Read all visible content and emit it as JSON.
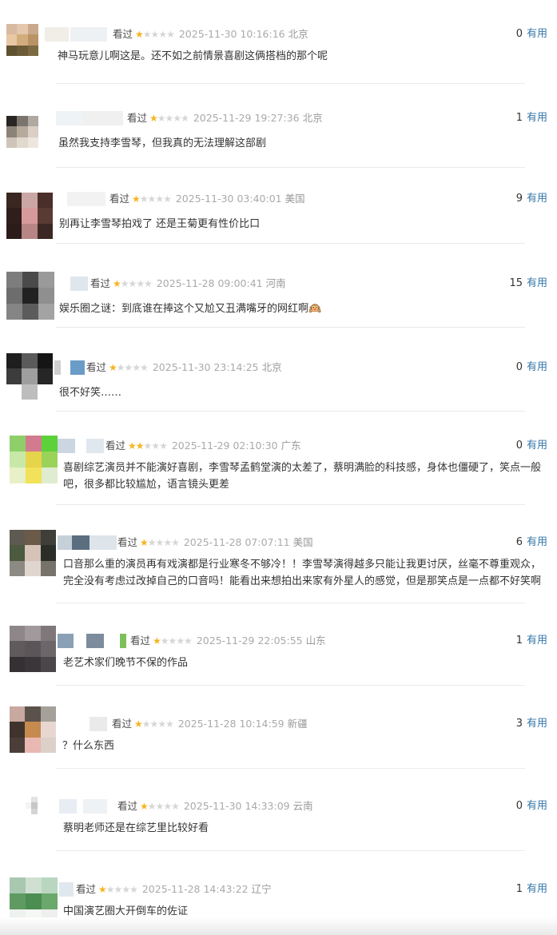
{
  "page": {
    "accent_color": "#3377aa",
    "star_on_color": "#f5b51f",
    "star_off_color": "#d6d6d6"
  },
  "reviews": [
    {
      "status": "看过",
      "rating": 1,
      "time": "2025-11-30 10:16:16",
      "location": "北京",
      "votes": "0",
      "useful_label": "有用",
      "content": "神马玩意儿啊这是。还不如之前情景喜剧这俩搭档的那个呢",
      "avatar_colors": [
        "#d8b9a1",
        "#e4c7ad",
        "#c9a98a",
        "#e8c7a4",
        "#d2ad7b",
        "#b99266",
        "#5e5230",
        "#6b5b38",
        "#7c6a42"
      ]
    },
    {
      "status": "看过",
      "rating": 1,
      "time": "2025-11-29 19:27:36",
      "location": "北京",
      "votes": "1",
      "useful_label": "有用",
      "content": "虽然我支持李雪琴，但我真的无法理解这部剧",
      "avatar_colors": [
        "#2a2623",
        "#7a746d",
        "#b0a9a1",
        "#8c8378",
        "#b7aa9d",
        "#d9cfc4",
        "#cfc4b8",
        "#e1d8ce",
        "#ece6df"
      ]
    },
    {
      "status": "看过",
      "rating": 1,
      "time": "2025-11-30 03:40:01",
      "location": "美国",
      "votes": "9",
      "useful_label": "有用",
      "content": "别再让李雪琴拍戏了 还是王菊更有性价比口",
      "avatar_colors": [
        "#3a2722",
        "#caa7a4",
        "#4a2e29",
        "#2f1e1a",
        "#d79a9c",
        "#5a3a35",
        "#2c1c19",
        "#b78583",
        "#3b2825"
      ]
    },
    {
      "status": "看过",
      "rating": 1,
      "time": "2025-11-28 09:00:41",
      "location": "河南",
      "votes": "15",
      "useful_label": "有用",
      "content": "娱乐圈之谜：到底谁在捧这个又尬又丑满嘴牙的网红啊🙉",
      "avatar_colors": [
        "#7d7d7d",
        "#4a4a4a",
        "#9a9a9a",
        "#6d6d6d",
        "#222222",
        "#8f8f8f",
        "#858585",
        "#5c5c5c",
        "#a3a3a3"
      ]
    },
    {
      "status": "看过",
      "rating": 1,
      "time": "2025-11-30 23:14:25",
      "location": "北京",
      "votes": "0",
      "useful_label": "有用",
      "content": "很不好笑……",
      "avatar_colors": [
        "#1e1e1e",
        "#5a5a5a",
        "#151515",
        "#3c3c3c",
        "#9e9e9e",
        "#262626",
        "#ffffff",
        "#bdbdbd",
        "#ffffff"
      ]
    },
    {
      "status": "看过",
      "rating": 2,
      "time": "2025-11-29 02:10:30",
      "location": "广东",
      "votes": "0",
      "useful_label": "有用",
      "content": "喜剧综艺演员并不能演好喜剧，李雪琴孟鹤堂演的太差了，蔡明满脸的科技感，身体也僵硬了，笑点一般吧，很多都比较尴尬，语言镜头更差",
      "avatar_colors": [
        "#8fcf6a",
        "#d27b8f",
        "#5dd13a",
        "#c8e8a8",
        "#e6d44a",
        "#9bd35a",
        "#e8f0c8",
        "#f2e25a",
        "#e0ecd0"
      ]
    },
    {
      "status": "看过",
      "rating": 1,
      "time": "2025-11-28 07:07:11",
      "location": "美国",
      "votes": "6",
      "useful_label": "有用",
      "content": "口音那么重的演员再有戏演都是行业寒冬不够冷！！李雪琴演得越多只能让我更讨厌，丝毫不尊重观众，完全没有考虑过改掉自己的口音吗！能看出来想拍出来家有外星人的感觉，但是那笑点是一点都不好笑啊",
      "avatar_colors": [
        "#5e5a52",
        "#6b5a48",
        "#3d3f38",
        "#4c5a3f",
        "#d6c2b6",
        "#2b2d28",
        "#8c8a82",
        "#e0d6cf",
        "#77736b"
      ]
    },
    {
      "status": "看过",
      "rating": 1,
      "time": "2025-11-29 22:05:55",
      "location": "山东",
      "votes": "1",
      "useful_label": "有用",
      "content": "老艺术家们晚节不保的作品",
      "avatar_colors": [
        "#8e8689",
        "#a09a9d",
        "#7f777a",
        "#605a5d",
        "#5a5558",
        "#6c6669",
        "#343033",
        "#3b3739",
        "#4a4649"
      ]
    },
    {
      "status": "看过",
      "rating": 1,
      "time": "2025-11-28 10:14:59",
      "location": "新疆",
      "votes": "3",
      "useful_label": "有用",
      "content": "？什么东西",
      "avatar_colors": [
        "#c9a8a0",
        "#5b524c",
        "#a6a09a",
        "#3e342d",
        "#c68a4f",
        "#e7d7d0",
        "#4a3f38",
        "#e9b8b2",
        "#dcd0c9"
      ]
    },
    {
      "status": "看过",
      "rating": 1,
      "time": "2025-11-30 14:33:09",
      "location": "云南",
      "votes": "0",
      "useful_label": "有用",
      "content": "蔡明老师还是在综艺里比较好看",
      "avatar_colors": [
        "#ffffff",
        "#e2e2e2",
        "#ffffff",
        "#f4f4f4",
        "#c6c6c6",
        "#ffffff",
        "#ffffff",
        "#d4d4d4",
        "#ffffff"
      ]
    },
    {
      "status": "看过",
      "rating": 1,
      "time": "2025-11-28 14:43:22",
      "location": "辽宁",
      "votes": "1",
      "useful_label": "有用",
      "content": "中国演艺圈大开倒车的佐证",
      "avatar_colors": [
        "#a8c8b0",
        "#cfe0d2",
        "#b9d6c0",
        "#5f9a62",
        "#4c8d52",
        "#6aa86c",
        "#eef2ee",
        "#f5f7f5",
        "#eef0ee"
      ]
    }
  ]
}
